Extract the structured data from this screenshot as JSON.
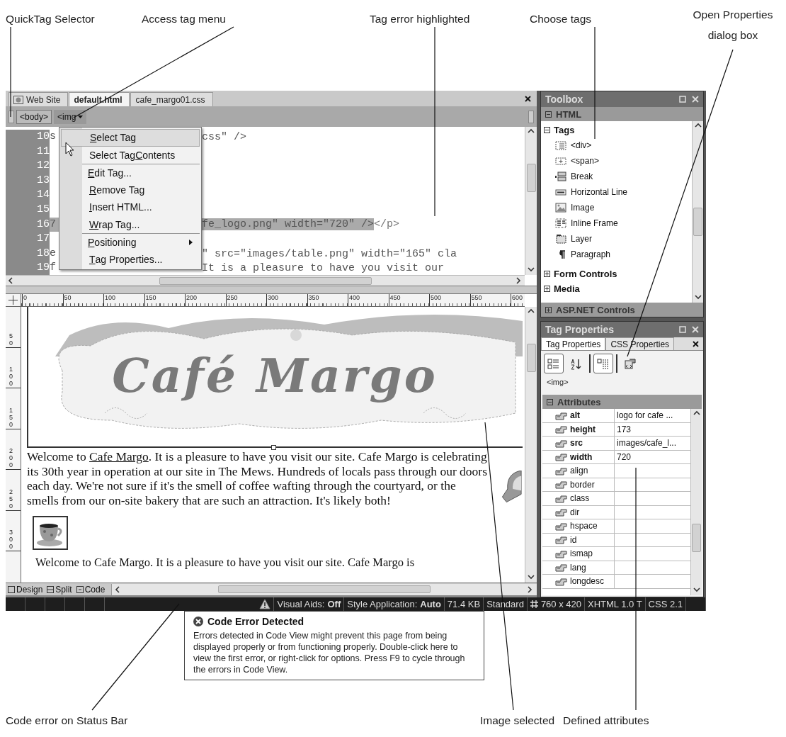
{
  "callouts_top": [
    "QuickTag Selector",
    "Access tag menu",
    "Tag error highlighted",
    "Choose tags",
    "Open Properties dialog box"
  ],
  "callouts_bottom": [
    "Code error on Status Bar",
    "Image selected",
    "Defined attributes"
  ],
  "editor_tabs": [
    {
      "label": "Web Site",
      "selected": false
    },
    {
      "label": "default.html",
      "selected": true
    },
    {
      "label": "cafe_margo01.css",
      "selected": false
    }
  ],
  "quick_tags": [
    {
      "label": "<body>",
      "selected": false,
      "dropdown": false
    },
    {
      "label": "<img",
      "selected": true,
      "dropdown": true
    }
  ],
  "code_lines": [
    {
      "number": "10",
      "head": "s",
      "tail": "css\" />",
      "highlighted": false
    },
    {
      "number": "11",
      "highlighted": false
    },
    {
      "number": "12",
      "highlighted": false
    },
    {
      "number": "13",
      "highlighted": false
    },
    {
      "number": "14",
      "highlighted": false
    },
    {
      "number": "15",
      "highlighted": false
    },
    {
      "number": "16",
      "head": "7",
      "tail": "fe_logo.png\" width=\"720\" />",
      "after": "</p>",
      "highlighted": true
    },
    {
      "number": "17",
      "highlighted": false
    },
    {
      "number": "18",
      "head": "e",
      "tail": "\" src=\"images/table.png\" width=\"165\" cla",
      "highlighted": false
    },
    {
      "number": "19",
      "head": "f",
      "tail": "It is a pleasure to have you visit our",
      "highlighted": false
    }
  ],
  "tag_menu": [
    {
      "key": "S",
      "after": "elect Tag",
      "selected": true,
      "separator_before": false,
      "submenu": false
    },
    {
      "before": "Select Tag ",
      "key": "C",
      "after": "ontents",
      "selected": false,
      "separator_before": false,
      "submenu": false
    },
    {
      "key": "E",
      "after": "dit Tag...",
      "selected": false,
      "separator_before": true,
      "submenu": false
    },
    {
      "key": "R",
      "after": "emove Tag",
      "selected": false,
      "separator_before": false,
      "submenu": false
    },
    {
      "key": "I",
      "after": "nsert HTML...",
      "selected": false,
      "separator_before": false,
      "submenu": false
    },
    {
      "key": "W",
      "after": "rap Tag...",
      "selected": false,
      "separator_before": false,
      "submenu": false
    },
    {
      "key": "P",
      "after": "ositioning",
      "selected": false,
      "separator_before": true,
      "submenu": true
    },
    {
      "key": "T",
      "after": "ag Properties...",
      "selected": false,
      "separator_before": false,
      "submenu": false
    }
  ],
  "ruler": {
    "horizontal": [
      "0",
      "50",
      "100",
      "150",
      "200",
      "250",
      "300",
      "350",
      "400",
      "450",
      "500",
      "550",
      "600"
    ],
    "vertical": [
      "50",
      "100",
      "150",
      "200",
      "250",
      "300"
    ]
  },
  "design": {
    "banner_title": "Café Margo",
    "paragraph": {
      "before": "Welcome to ",
      "link": "Cafe Margo",
      "after": ". It is a pleasure to have you visit our site. Cafe Margo is celebrating its 30th year in operation at our site in The Mews. Hundreds of locals pass through our doors each day. We're not sure if it's the smell of coffee wafting through the courtyard, or the smells from our on-site bakery that are such an attraction. It's likely both!"
    },
    "paragraph_2": "Welcome to Cafe Margo. It is a pleasure to have you visit our site. Cafe Margo is"
  },
  "view_buttons": [
    "Design",
    "Split",
    "Code"
  ],
  "toolbox": {
    "title": "Toolbox",
    "sections": [
      {
        "title": "HTML",
        "expanded": true,
        "children": [
          {
            "title": "Tags",
            "expanded": true,
            "children": [
              {
                "label": "<div>"
              },
              {
                "label": "<span>"
              },
              {
                "label": "Break"
              },
              {
                "label": "Horizontal Line"
              },
              {
                "label": "Image"
              },
              {
                "label": "Inline Frame"
              },
              {
                "label": "Layer"
              },
              {
                "label": "Paragraph"
              }
            ]
          },
          {
            "title": "Form Controls",
            "expanded": false
          },
          {
            "title": "Media",
            "expanded": false
          }
        ]
      },
      {
        "title": "ASP.NET Controls",
        "expanded": false
      }
    ]
  },
  "tag_properties": {
    "title": "Tag Properties",
    "tabs": [
      {
        "label": "Tag Properties",
        "selected": true
      },
      {
        "label": "CSS Properties",
        "selected": false
      }
    ],
    "toolbar": [
      {
        "pressed": true
      },
      {
        "pressed": false
      },
      {
        "pressed": true
      },
      {
        "pressed": false
      }
    ],
    "element": "<img>",
    "group": {
      "title": "Attributes",
      "expanded": true
    },
    "attributes": [
      {
        "name": "alt",
        "value": "logo for cafe ...",
        "set": true
      },
      {
        "name": "height",
        "value": "173",
        "set": true
      },
      {
        "name": "src",
        "value": "images/cafe_l...",
        "set": true
      },
      {
        "name": "width",
        "value": "720",
        "set": true
      },
      {
        "name": "align",
        "set": false
      },
      {
        "name": "border",
        "set": false
      },
      {
        "name": "class",
        "set": false
      },
      {
        "name": "dir",
        "set": false
      },
      {
        "name": "hspace",
        "set": false
      },
      {
        "name": "id",
        "set": false
      },
      {
        "name": "ismap",
        "set": false
      },
      {
        "name": "lang",
        "set": false
      },
      {
        "name": "longdesc",
        "set": false
      }
    ]
  },
  "status_bar": {
    "code_error": true,
    "items": [
      {
        "label": "Visual Aids:",
        "value": "Off"
      },
      {
        "label": "Style Application:",
        "value": "Auto"
      },
      {
        "label": "71.4 KB"
      },
      {
        "label": "Standard"
      },
      {
        "label": "760 x 420",
        "kind": "size"
      },
      {
        "label": "XHTML 1.0 T"
      },
      {
        "label": "CSS 2.1"
      }
    ]
  },
  "error_tooltip": {
    "title": "Code Error Detected",
    "text": "Errors detected in Code View might prevent this page from being displayed properly or from functioning properly. Double-click here to view the first error, or right-click for options. Press F9 to cycle through the errors in Code View."
  }
}
